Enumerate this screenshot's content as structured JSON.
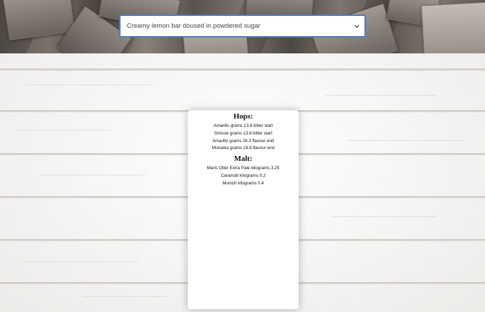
{
  "recipe_select": {
    "selected": "Creamy lemon bar doused in powdered sugar",
    "icon": "chevron-down-icon"
  },
  "card": {
    "hops_heading": "Hops:",
    "hops": [
      "Amarillo grams 13.8 bitter start",
      "Simcoe grams 13.8 bitter start",
      "Amarillo grams 26.3 flavour end",
      "Motueka grams 18.8 flavour end"
    ],
    "malt_heading": "Malt:",
    "malt": [
      "Maris Otter Extra Pale kilograms 3.25",
      "Caramalt kilograms 0.2",
      "Munich kilograms 0.4"
    ]
  },
  "colors": {
    "select_border": "#4a7fc4",
    "card_background": "#ffffff"
  }
}
